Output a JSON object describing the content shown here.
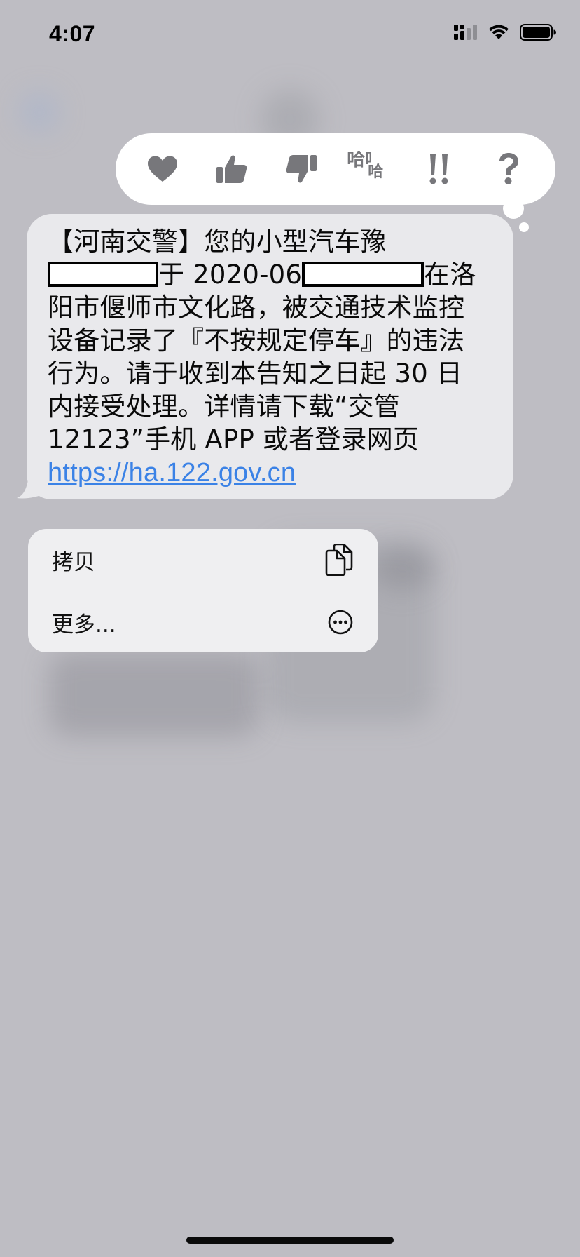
{
  "status_bar": {
    "time": "4:07",
    "icons": [
      "signal-icon",
      "wifi-icon",
      "battery-icon"
    ]
  },
  "tapback": {
    "reactions": [
      "heart-icon",
      "thumbs-up-icon",
      "thumbs-down-icon",
      "haha-icon",
      "exclamation-icon",
      "question-icon"
    ],
    "haha_text": "哈哈",
    "exclamation_text": "!!",
    "question_text": "?"
  },
  "message": {
    "line1": "【河南交警】您的小型汽车豫",
    "line2_after": "于 2020-06",
    "line2_end": "在洛",
    "line3": "阳市偃师市文化路，被交通技术监控",
    "line4": "设备记录了『不按规定停车』的违法",
    "line5": "行为。请于收到本告知之日起 30 日",
    "line6": "内接受处理。详情请下载“交管",
    "line7": "12123”手机 APP 或者登录网页",
    "link": "https://ha.122.gov.cn"
  },
  "context_menu": {
    "copy_label": "拷贝",
    "more_label": "更多..."
  },
  "colors": {
    "background": "#bebdc3",
    "bubble": "#e9e9ec",
    "link": "#3b82e6",
    "icon_gray": "#77777b"
  }
}
